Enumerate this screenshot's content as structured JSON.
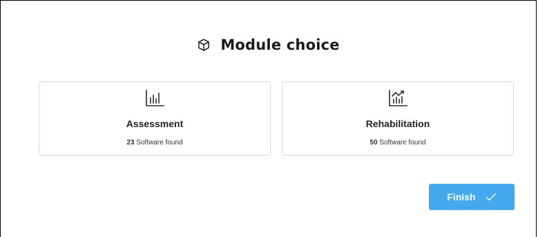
{
  "header": {
    "title": "Module choice",
    "icon": "cube-icon"
  },
  "modules": [
    {
      "title": "Assessment",
      "count": "23",
      "count_suffix": "Software found",
      "icon": "bar-chart-icon"
    },
    {
      "title": "Rehabilitation",
      "count": "50",
      "count_suffix": "Software found",
      "icon": "chart-trend-icon"
    }
  ],
  "actions": {
    "finish_label": "Finish",
    "finish_icon": "checkmark-icon",
    "accent_color": "#43a9ec"
  }
}
